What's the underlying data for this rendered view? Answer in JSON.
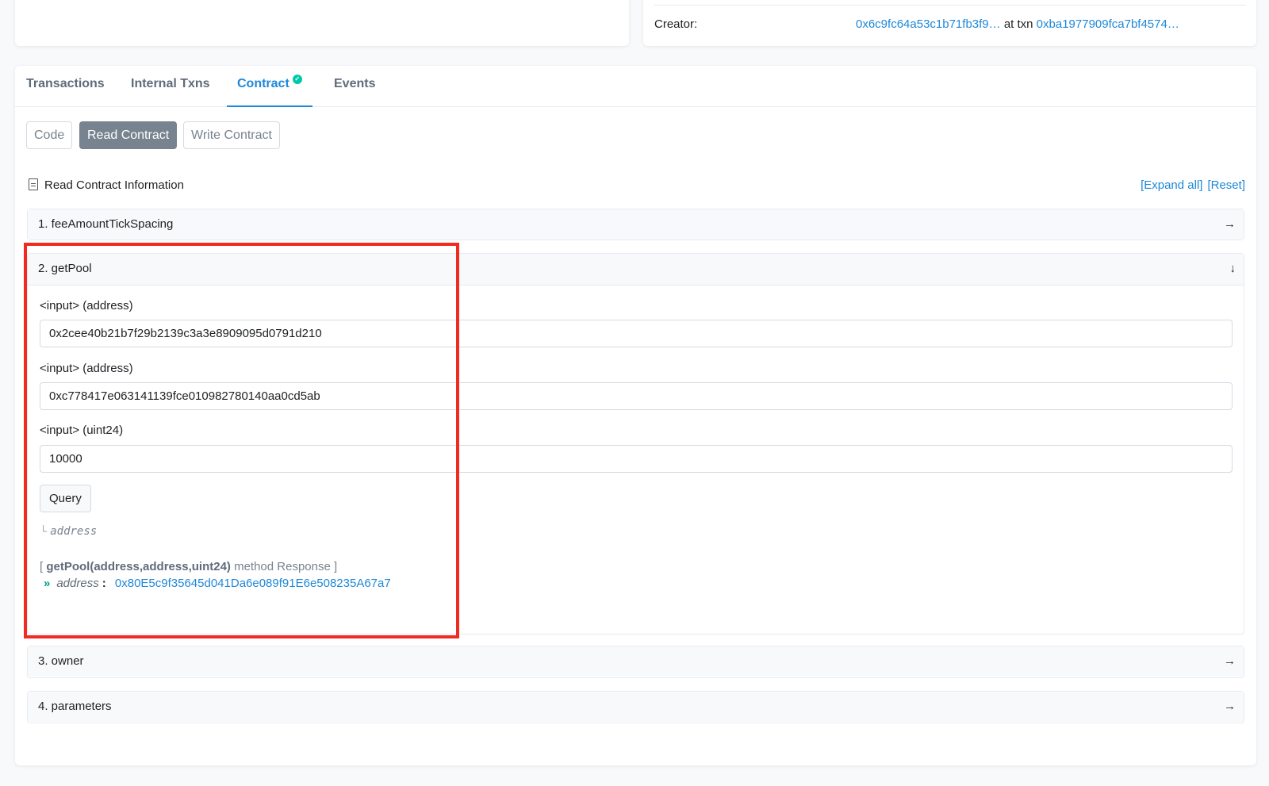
{
  "creator": {
    "label": "Creator:",
    "address": "0x6c9fc64a53c1b71fb3f9…",
    "at_txn": "at txn",
    "txn": "0xba1977909fca7bf4574…"
  },
  "tabs": [
    {
      "label": "Transactions"
    },
    {
      "label": "Internal Txns"
    },
    {
      "label": "Contract"
    },
    {
      "label": "Events"
    }
  ],
  "subtabs": {
    "code": "Code",
    "read": "Read Contract",
    "write": "Write Contract"
  },
  "info": {
    "title": "Read Contract Information",
    "expand_all": "[Expand all]",
    "reset": "[Reset]"
  },
  "methods": {
    "m1": "1. feeAmountTickSpacing",
    "m2": "2. getPool",
    "m3": "3. owner",
    "m4": "4. parameters"
  },
  "getPool": {
    "inputs": [
      {
        "label": "<input> (address)",
        "value": "0x2cee40b21b7f29b2139c3a3e8909095d0791d210"
      },
      {
        "label": "<input> (address)",
        "value": "0xc778417e063141139fce010982780140aa0cd5ab"
      },
      {
        "label": "<input> (uint24)",
        "value": "10000"
      }
    ],
    "query": "Query",
    "return_corner": "└",
    "return_type": "address",
    "response_open": "[",
    "response_sig": "getPool(address,address,uint24)",
    "response_rest": "method Response ]",
    "response_chev": "»",
    "response_key": "address",
    "response_colon": ":",
    "response_value": "0x80E5c9f35645d041Da6e089f91E6e508235A67a7"
  },
  "icons": {
    "arrow_right": "→",
    "arrow_down": "↓",
    "check": "✓"
  },
  "colors": {
    "link": "#1e88d8",
    "highlight": "#f12b20",
    "verified": "#00c9a7"
  }
}
